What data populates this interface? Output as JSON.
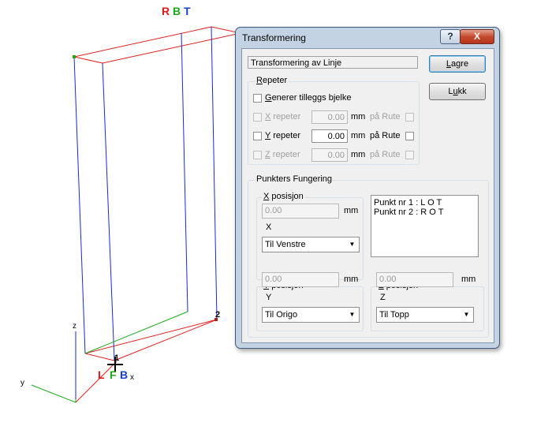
{
  "viewport": {
    "top_labels": [
      {
        "text": "R",
        "color": "#e01818"
      },
      {
        "text": "B",
        "color": "#18a818"
      },
      {
        "text": "T",
        "color": "#1840d0"
      }
    ],
    "bottom_labels": [
      {
        "text": "L",
        "color": "#e01818"
      },
      {
        "text": "F",
        "color": "#18a818"
      },
      {
        "text": "B",
        "color": "#1840d0"
      }
    ],
    "axis_x": "x",
    "axis_y": "y",
    "axis_z": "z",
    "node_1": "1",
    "node_2": "2"
  },
  "dialog": {
    "title": "Transformering",
    "help_glyph": "?",
    "close_glyph": "X",
    "description_value": "Transformering av Linje",
    "save_label": "Lagre",
    "save_mnemonic": "L",
    "save_rest": "agre",
    "close_label": "Lukk",
    "close_pre": "L",
    "close_mnemonic": "u",
    "close_rest": "kk",
    "repeat": {
      "title_mnemonic": "R",
      "title_rest": "epeter",
      "extra_beam_mnemonic": "G",
      "extra_beam_rest": "enerer tilleggs bjelke",
      "x_mnemonic": "X",
      "x_rest": " repeter",
      "y_mnemonic": "Y",
      "y_rest": " repeter",
      "z_mnemonic": "Z",
      "z_rest": " repeter",
      "x_value": "0.00",
      "y_value": "0.00",
      "z_value": "0.00",
      "unit": "mm",
      "on_grid": "på Rute"
    },
    "points": {
      "title": "Punkters Fungering",
      "x_group_mnemonic": "X",
      "x_group_rest": " posisjon",
      "y_group_mnemonic": "Y",
      "y_group_rest": " posisjon",
      "z_group_mnemonic": "Z",
      "z_group_rest": " posisjon",
      "x_value": "0.00",
      "y_value": "0.00",
      "z_value": "0.00",
      "unit": "mm",
      "x_axis": "X",
      "y_axis": "Y",
      "z_axis": "Z",
      "x_select": "Til Venstre",
      "y_select": "Til Origo",
      "z_select": "Til Topp",
      "list_items": [
        "Punkt nr 1 :  L   O   T",
        "Punkt nr 2 :  R   O   T"
      ]
    }
  }
}
